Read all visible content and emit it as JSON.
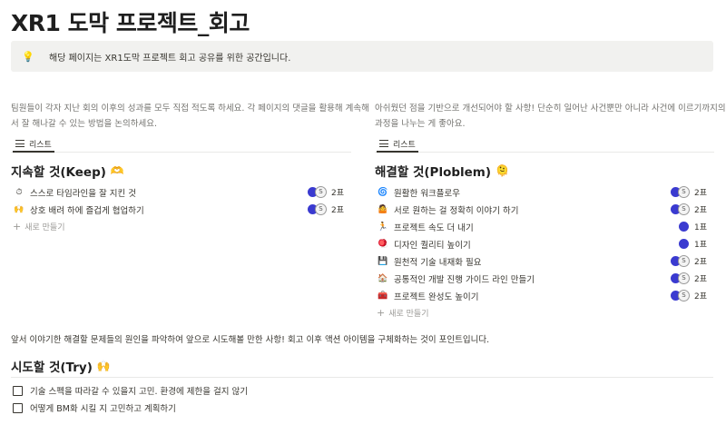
{
  "page": {
    "title": "XR1 도막 프로젝트_회고",
    "callout_icon": "lightbulb-icon",
    "callout_emoji": "💡",
    "callout_text": "해당 페이지는 XR1도막 프로젝트 회고 공유를 위한 공간입니다."
  },
  "left": {
    "desc_line1": "팀원들이 각자 지난 회의 이후의 성과를 모두 직접 적도록 하세요. 각 페이지의 댓글을 활용해 계속해",
    "desc_line2": "서 잘 해나갈 수 있는 방법을 논의하세요.",
    "tab_label": "리스트",
    "board_title": "지속할 것(Keep)",
    "board_emoji": "🫶",
    "items": [
      {
        "icon": "⏱",
        "label": "스스로 타임라인을 잘 지킨 것",
        "count": "2표"
      },
      {
        "icon": "🙌",
        "label": "상호 배려 하에 즐겁게 협업하기",
        "count": "2표"
      }
    ],
    "new_label": "새로 만들기"
  },
  "right": {
    "desc_line1": "아쉬웠던 점을 기반으로 개선되어야 할 사항! 단순히 일어난 사건뿐만 아니라 사건에 이르기까지의",
    "desc_line2": "과정을 나누는 게 좋아요.",
    "tab_label": "리스트",
    "board_title": "해결할 것(Ploblem)",
    "board_emoji": "🫠",
    "items": [
      {
        "icon": "🌀",
        "label": "원활한 워크플로우",
        "count": "2표"
      },
      {
        "icon": "🤷",
        "label": "서로 원하는 걸 정확히 이야기 하기",
        "count": "2표"
      },
      {
        "icon": "🏃",
        "label": "프로젝트 속도 더 내기",
        "count": "1표"
      },
      {
        "icon": "🪀",
        "label": "디자인 퀄리티 높이기",
        "count": "1표"
      },
      {
        "icon": "💾",
        "label": "원천적 기술 내재화 필요",
        "count": "2표"
      },
      {
        "icon": "🏠",
        "label": "공통적인 개발 진행 가이드 라인 만들기",
        "count": "2표"
      },
      {
        "icon": "🧰",
        "label": "프로젝트 완성도 높이기",
        "count": "2표"
      }
    ],
    "new_label": "새로 만들기"
  },
  "try": {
    "summary": "앞서 이야기한 해결할 문제들의 원인을 파악하여 앞으로 시도해볼 만한 사항! 회고 이후 액션 아이템을 구체화하는 것이 포인트입니다.",
    "title": "시도할 것(Try)",
    "emoji": "🙌",
    "todos": [
      "기술 스펙을 따라갈 수 있을지 고민. 환경에 제한을 걸지 않기",
      "어떻게 BM화 시킬 지 고민하고 계획하기"
    ]
  },
  "colors": {
    "avatar_blue": "#3a3ad0",
    "text": "#37352f",
    "callout_bg": "#f1f1ef"
  }
}
